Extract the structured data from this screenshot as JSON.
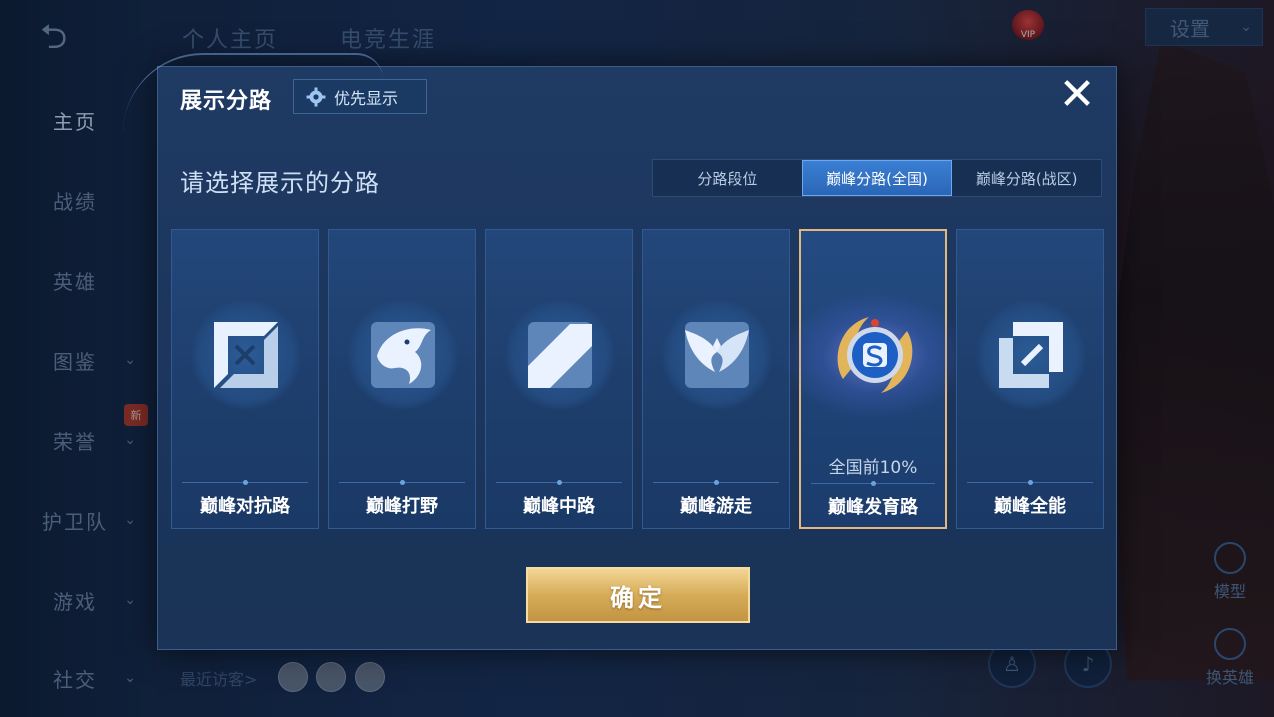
{
  "sidebar": {
    "items": [
      {
        "label": "主页",
        "active": true,
        "has_chevron": false
      },
      {
        "label": "战绩",
        "active": false,
        "has_chevron": false
      },
      {
        "label": "英雄",
        "active": false,
        "has_chevron": false
      },
      {
        "label": "图鉴",
        "active": false,
        "has_chevron": true
      },
      {
        "label": "荣誉",
        "active": false,
        "has_chevron": true
      },
      {
        "label": "护卫队",
        "active": false,
        "has_chevron": true
      },
      {
        "label": "游戏",
        "active": false,
        "has_chevron": true
      },
      {
        "label": "社交",
        "active": false,
        "has_chevron": true
      }
    ],
    "new_badge": "新"
  },
  "header": {
    "tabs": [
      "个人主页",
      "电竞生涯"
    ],
    "vip_label": "VIP",
    "settings_label": "设置"
  },
  "right_panel": {
    "model_label": "模型",
    "switch_hero_label": "换英雄"
  },
  "footer": {
    "visitors_label": "最近访客>"
  },
  "modal": {
    "title": "展示分路",
    "priority_button": "优先显示",
    "prompt": "请选择展示的分路",
    "segments": [
      {
        "label": "分路段位",
        "active": false
      },
      {
        "label": "巅峰分路(全国)",
        "active": true
      },
      {
        "label": "巅峰分路(战区)",
        "active": false
      }
    ],
    "cards": [
      {
        "label": "巅峰对抗路",
        "rank": "",
        "selected": false,
        "icon": "clash-lane-icon"
      },
      {
        "label": "巅峰打野",
        "rank": "",
        "selected": false,
        "icon": "jungle-icon"
      },
      {
        "label": "巅峰中路",
        "rank": "",
        "selected": false,
        "icon": "mid-lane-icon"
      },
      {
        "label": "巅峰游走",
        "rank": "",
        "selected": false,
        "icon": "roam-icon"
      },
      {
        "label": "巅峰发育路",
        "rank": "全国前10%",
        "selected": true,
        "icon": "farm-lane-icon"
      },
      {
        "label": "巅峰全能",
        "rank": "",
        "selected": false,
        "icon": "all-round-icon"
      }
    ],
    "confirm_button": "确定"
  },
  "colors": {
    "accent_blue": "#2b66b6",
    "gold": "#d6ac58",
    "selected_border": "#e4b87c"
  }
}
